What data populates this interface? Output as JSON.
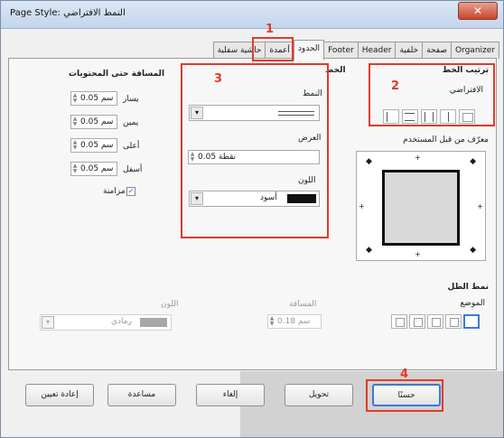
{
  "window": {
    "title": "Page Style: النمط الافتراضي",
    "close_glyph": "✕"
  },
  "tabs": [
    {
      "label": "Organizer"
    },
    {
      "label": "صفحة"
    },
    {
      "label": "خلفية"
    },
    {
      "label": "Header"
    },
    {
      "label": "Footer"
    },
    {
      "label": "الحدود"
    },
    {
      "label": "أعمدة"
    },
    {
      "label": "حاشية سفلية"
    }
  ],
  "presets": {
    "title": "ترتيب الخط",
    "default_label": "الافتراضي"
  },
  "user_defined_label": "معرّف من قبل المستخدم",
  "line": {
    "title": "الخط",
    "style_label": "النمط",
    "width_label": "العرض",
    "width_value": "0.05 نقطة",
    "color_label": "اللون",
    "color_value": "أسود",
    "color_swatch": "#111111"
  },
  "spacing": {
    "title": "المسافة حتى المحتويات",
    "left_label": "يسار",
    "left_value": "0.05 سم",
    "right_label": "يمين",
    "right_value": "0.05 سم",
    "top_label": "أعلى",
    "top_value": "0.05 سم",
    "bottom_label": "أسفل",
    "bottom_value": "0.05 سم",
    "sync_label": "مزامنة",
    "sync_checked": "✓"
  },
  "shadow": {
    "title": "نمط الظل",
    "position_label": "الموضع",
    "distance_label": "المسافة",
    "distance_value": "0.18 سم",
    "color_label": "اللون",
    "color_value": "رمادي"
  },
  "annotations": {
    "n1": "1",
    "n2": "2",
    "n3": "3",
    "n4": "4",
    "color": "#e13a2a"
  },
  "buttons": {
    "ok": "حسنًا",
    "cancel": "إلغاء",
    "help": "مساعدة",
    "reset": "إعادة تعيين",
    "revert": "تحويل"
  }
}
